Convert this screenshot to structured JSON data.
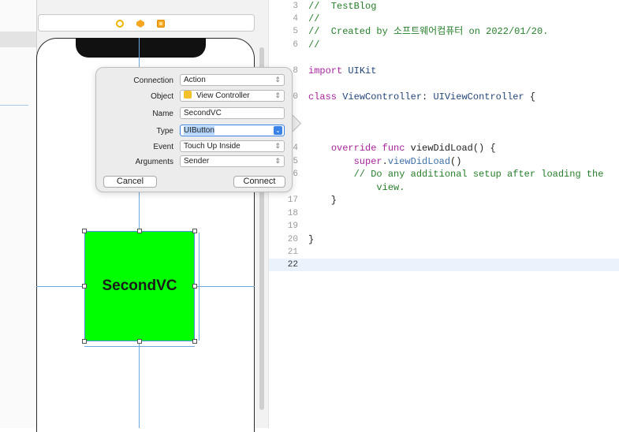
{
  "colors": {
    "accent": "#3b82e6",
    "button_fill": "#00ff00",
    "comment": "#267e2b",
    "keyword": "#a8239c"
  },
  "canvas": {
    "toolbar_icons": [
      "first-responder-icon",
      "exit-icon",
      "view-controller-icon"
    ],
    "button_label": "SecondVC"
  },
  "popover": {
    "connection": {
      "label": "Connection",
      "value": "Action"
    },
    "object": {
      "label": "Object",
      "value": "View Controller"
    },
    "name": {
      "label": "Name",
      "value": "SecondVC"
    },
    "type": {
      "label": "Type",
      "value": "UIButton"
    },
    "event": {
      "label": "Event",
      "value": "Touch Up Inside"
    },
    "arguments": {
      "label": "Arguments",
      "value": "Sender"
    },
    "cancel_label": "Cancel",
    "connect_label": "Connect"
  },
  "editor": {
    "lines": [
      {
        "num": "3",
        "text": "//  TestBlog"
      },
      {
        "num": "4",
        "text": "//"
      },
      {
        "num": "5",
        "text": "//  Created by 소프트웨어컴퓨터 on 2022/01/20."
      },
      {
        "num": "6",
        "text": "//"
      },
      {
        "num": "8",
        "text": "import UIKit"
      },
      {
        "num": "0",
        "text": "class ViewController: UIViewController {"
      },
      {
        "num": "4",
        "text": "    override func viewDidLoad() {"
      },
      {
        "num": "5",
        "text": "        super.viewDidLoad()"
      },
      {
        "num": "6",
        "text": "        // Do any additional setup after loading the"
      },
      {
        "num": "",
        "text": "            view."
      },
      {
        "num": "17",
        "text": "    }"
      },
      {
        "num": "18",
        "text": ""
      },
      {
        "num": "19",
        "text": ""
      },
      {
        "num": "20",
        "text": "}"
      },
      {
        "num": "21",
        "text": ""
      },
      {
        "num": "22",
        "text": ""
      }
    ]
  }
}
